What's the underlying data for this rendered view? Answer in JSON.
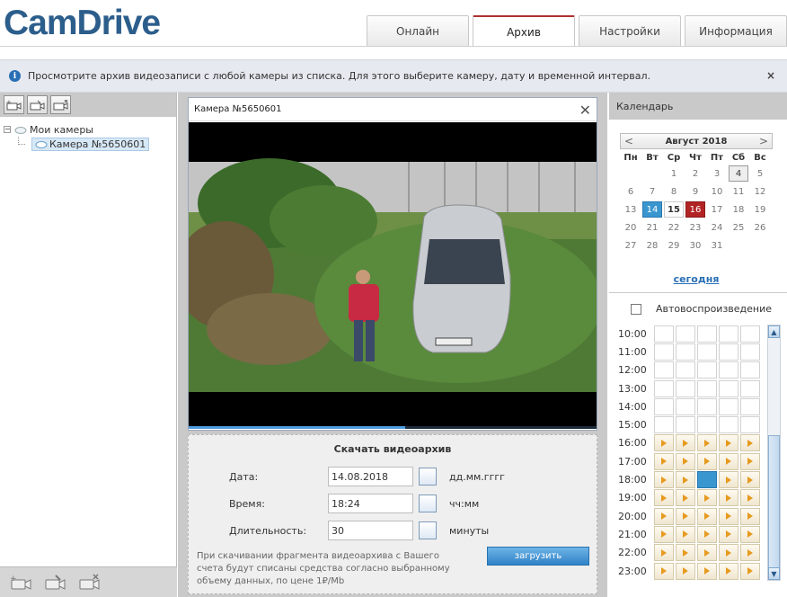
{
  "header": {
    "logo": "CamDrive"
  },
  "tabs": [
    {
      "label": "Онлайн",
      "active": false
    },
    {
      "label": "Архив",
      "active": true
    },
    {
      "label": "Настройки",
      "active": false
    },
    {
      "label": "Информация",
      "active": false
    }
  ],
  "info_bar": {
    "text": "Просмотрите архив видеозаписи с любой камеры из списка. Для этого выберите камеру, дату и временной интервал.",
    "close": "×"
  },
  "sidebar": {
    "tree": {
      "root": "Мои камеры",
      "camera": "Камера №5650601"
    }
  },
  "player": {
    "title": "Камера №5650601",
    "close": "✕",
    "progress": 0.53
  },
  "download": {
    "title": "Скачать видеоархив",
    "date_label": "Дата:",
    "date_value": "14.08.2018",
    "date_unit": "дд.мм.гггг",
    "time_label": "Время:",
    "time_value": "18:24",
    "time_unit": "чч:мм",
    "duration_label": "Длительность:",
    "duration_value": "30",
    "duration_unit": "минуты",
    "note": "При скачивании фрагмента видеоархива с Вашего счета будут списаны средства согласно выбранному объему данных, по цене 1₽/Mb",
    "button": "загрузить"
  },
  "calendar": {
    "header": "Календарь",
    "month": "Август 2018",
    "prev": "<",
    "next": ">",
    "weekdays": [
      "Пн",
      "Вт",
      "Ср",
      "Чт",
      "Пт",
      "Сб",
      "Вс"
    ],
    "today_link": "сегодня",
    "autoplay": "Автовоспроизведение",
    "hours": [
      "10:00",
      "11:00",
      "12:00",
      "13:00",
      "14:00",
      "15:00",
      "16:00",
      "17:00",
      "18:00",
      "19:00",
      "20:00",
      "21:00",
      "22:00",
      "23:00"
    ]
  },
  "colors": {
    "accent": "#2c5e8c",
    "selected_day": "#3a96cf",
    "record_day": "#b22424",
    "play_arrow": "#e69a1f"
  }
}
